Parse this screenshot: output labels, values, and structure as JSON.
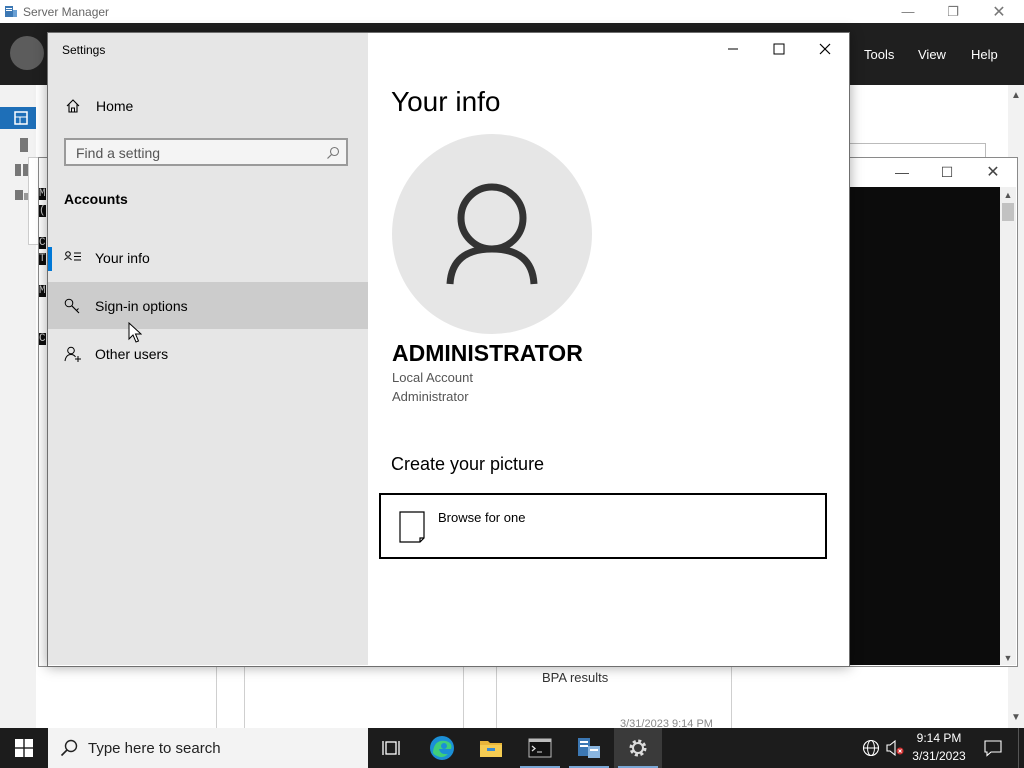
{
  "server_manager": {
    "title": "Server Manager",
    "menu": {
      "tools": "Tools",
      "view": "View",
      "help": "Help"
    },
    "bpa_label": "BPA results",
    "partial_date": "3/31/2023 9:14 PM"
  },
  "console": {
    "visible_chars": [
      "M",
      "(",
      "C",
      "T",
      "M",
      "C"
    ]
  },
  "settings": {
    "window_title": "Settings",
    "home_label": "Home",
    "search_placeholder": "Find a setting",
    "section_label": "Accounts",
    "nav_items": [
      {
        "label": "Your info",
        "icon": "contact-card-icon",
        "selected": true
      },
      {
        "label": "Sign-in options",
        "icon": "key-icon",
        "hovered": true
      },
      {
        "label": "Other users",
        "icon": "add-person-icon"
      }
    ],
    "content": {
      "heading": "Your info",
      "username": "ADMINISTRATOR",
      "account_type": "Local Account",
      "account_role": "Administrator",
      "create_picture_title": "Create your picture",
      "browse_label": "Browse for one"
    }
  },
  "taskbar": {
    "search_placeholder": "Type here to search",
    "apps": [
      "task-view-icon",
      "edge-icon",
      "file-explorer-icon",
      "terminal-icon",
      "server-manager-icon",
      "settings-gear-icon"
    ],
    "time": "9:14 PM",
    "date": "3/31/2023"
  },
  "colors": {
    "accent": "#0078d7",
    "nav_background": "#e6e6e6",
    "hover_background": "#cccccc",
    "taskbar": "#1c1c1c",
    "server_manager_header": "#1f1f1f"
  }
}
